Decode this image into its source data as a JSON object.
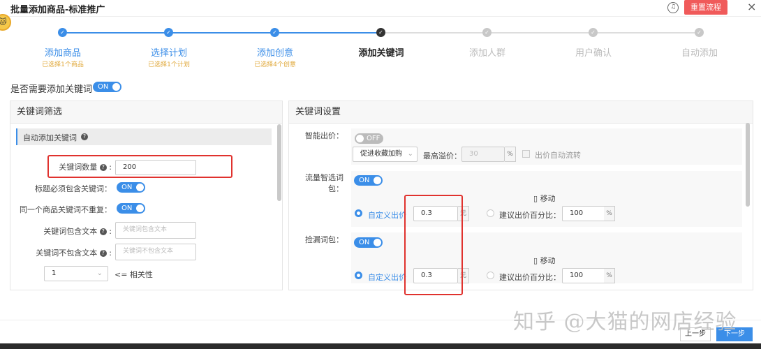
{
  "header": {
    "title": "批量添加商品-标准推广",
    "reset_label": "重置流程",
    "close": "×",
    "headset_glyph": "♫"
  },
  "steps": [
    {
      "label": "添加商品",
      "sub": "已选择1个商品",
      "state": "done"
    },
    {
      "label": "选择计划",
      "sub": "已选择1个计划",
      "state": "done"
    },
    {
      "label": "添加创意",
      "sub": "已选择4个创意",
      "state": "done"
    },
    {
      "label": "添加关键词",
      "sub": "",
      "state": "active"
    },
    {
      "label": "添加人群",
      "sub": "",
      "state": "todo"
    },
    {
      "label": "用户确认",
      "sub": "",
      "state": "todo"
    },
    {
      "label": "自动添加",
      "sub": "",
      "state": "todo"
    }
  ],
  "need_keywords": {
    "label": "是否需要添加关键词",
    "toggle": "ON"
  },
  "filter": {
    "title": "关键词筛选",
    "section": "自动添加关键词",
    "count_label": "关键词数量",
    "count_value": "200",
    "title_must_label": "标题必须包含关键词：",
    "title_must_toggle": "ON",
    "no_repeat_label": "同一个商品关键词不重复：",
    "no_repeat_toggle": "ON",
    "include_label": "关键词包含文本",
    "include_placeholder": "关键词包含文本",
    "exclude_label": "关键词不包含文本",
    "exclude_placeholder": "关键词不包含文本",
    "relevance_value": "1",
    "relevance_label": "<= 相关性"
  },
  "settings": {
    "title": "关键词设置",
    "smart_bid_label": "智能出价：",
    "smart_bid_toggle": "OFF",
    "strategy": "促进收藏加购",
    "max_premium_label": "最高溢价：",
    "max_premium_value": "30",
    "percent": "%",
    "auto_flow_label": "出价自动流转",
    "traffic_label": "流量智选词包：",
    "traffic_toggle": "ON",
    "traffic_device": "移动",
    "custom_bid_label": "自定义出价",
    "traffic_custom_value": "0.3",
    "yuan": "元",
    "suggest_label": "建议出价百分比：",
    "traffic_suggest_value": "100",
    "leak_label": "捡漏词包：",
    "leak_toggle": "ON",
    "leak_device": "移动",
    "leak_custom_value": "0.3",
    "leak_suggest_value": "100"
  },
  "footer": {
    "prev": "上一步",
    "next": "下一步"
  },
  "watermark": "知乎 @大猫的网店经验",
  "colors": {
    "accent": "#3b8ee8",
    "danger": "#f05a5a",
    "highlight": "#e0322e",
    "hint": "#e0a83a"
  }
}
